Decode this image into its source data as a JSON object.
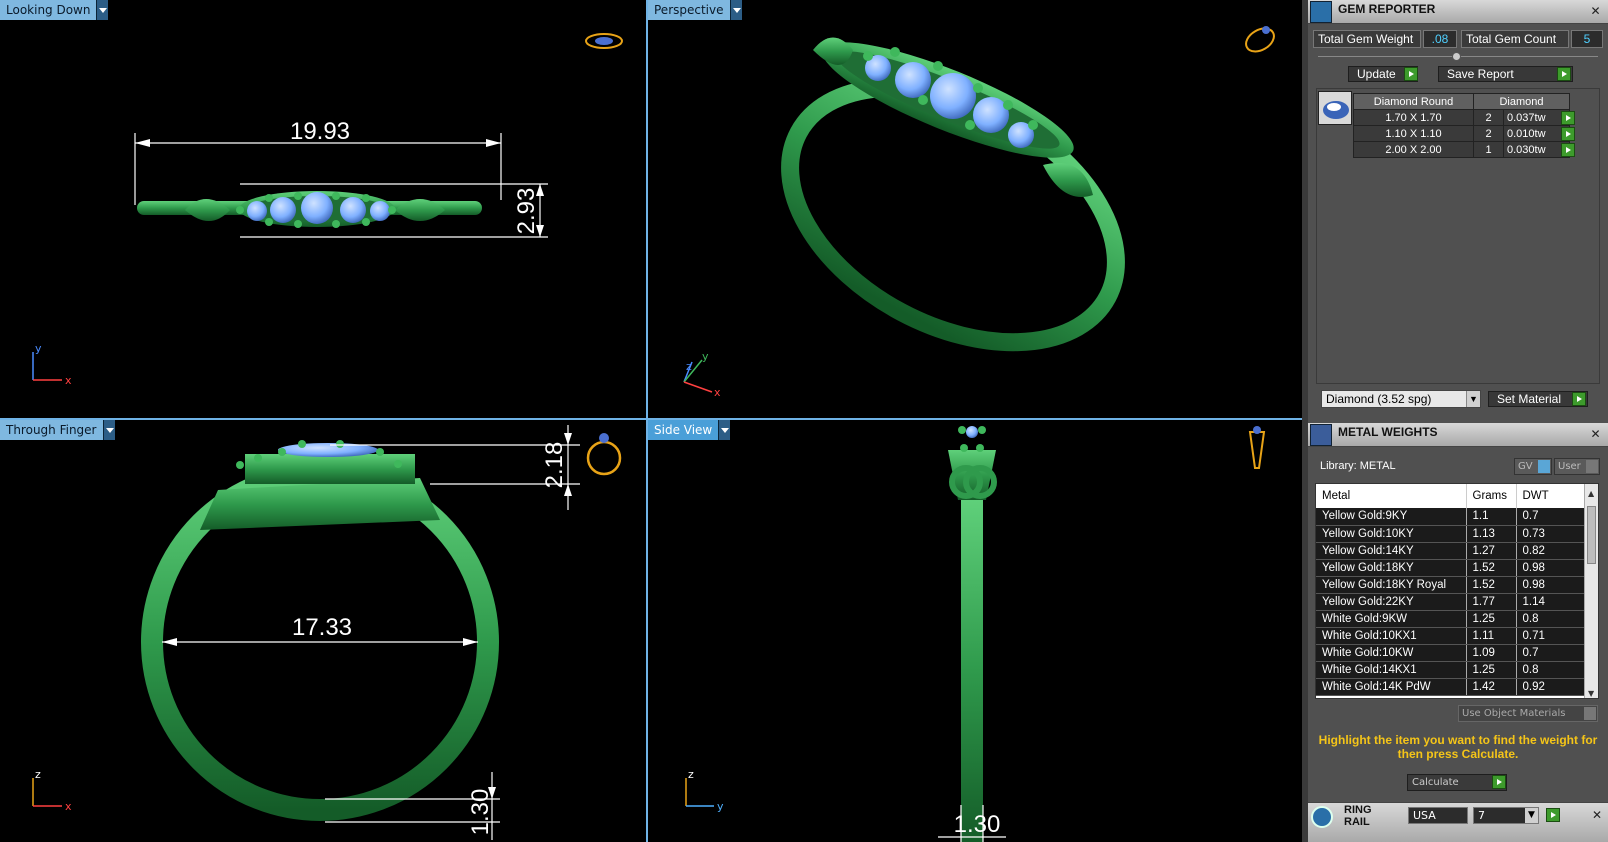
{
  "viewports": {
    "top_left": {
      "label": "Looking Down",
      "dim_width": "19.93",
      "dim_height": "2.93",
      "axes": [
        "y",
        "x"
      ]
    },
    "top_right": {
      "label": "Perspective",
      "axes": [
        "z",
        "y",
        "x"
      ]
    },
    "bottom_left": {
      "label": "Through Finger",
      "dim_top": "2.18",
      "dim_inner": "17.33",
      "dim_bottom": "1.30",
      "axes": [
        "z",
        "x"
      ]
    },
    "bottom_right": {
      "label": "Side View",
      "dim_bottom": "1.30",
      "axes": [
        "z",
        "y"
      ]
    }
  },
  "gem_reporter": {
    "title": "GEM REPORTER",
    "total_weight_label": "Total Gem Weight",
    "total_weight_value": ".08",
    "total_count_label": "Total Gem Count",
    "total_count_value": "5",
    "update_label": "Update",
    "save_label": "Save Report",
    "table_headers": [
      "Diamond Round",
      "Diamond"
    ],
    "rows": [
      {
        "size": "1.70 X 1.70",
        "count": "2",
        "tw": "0.037tw"
      },
      {
        "size": "1.10 X 1.10",
        "count": "2",
        "tw": "0.010tw"
      },
      {
        "size": "2.00 X 2.00",
        "count": "1",
        "tw": "0.030tw"
      }
    ],
    "material_select": "Diamond    (3.52 spg)",
    "set_material_label": "Set Material"
  },
  "metal_weights": {
    "title": "METAL WEIGHTS",
    "library_label": "Library: METAL",
    "gv_label": "GV",
    "user_label": "User",
    "headers": [
      "Metal",
      "Grams",
      "DWT"
    ],
    "rows": [
      {
        "metal": "Yellow Gold:9KY",
        "grams": "1.1",
        "dwt": "0.7"
      },
      {
        "metal": "Yellow Gold:10KY",
        "grams": "1.13",
        "dwt": "0.73"
      },
      {
        "metal": "Yellow Gold:14KY",
        "grams": "1.27",
        "dwt": "0.82"
      },
      {
        "metal": "Yellow Gold:18KY",
        "grams": "1.52",
        "dwt": "0.98"
      },
      {
        "metal": "Yellow Gold:18KY Royal",
        "grams": "1.52",
        "dwt": "0.98"
      },
      {
        "metal": "Yellow Gold:22KY",
        "grams": "1.77",
        "dwt": "1.14"
      },
      {
        "metal": "White Gold:9KW",
        "grams": "1.25",
        "dwt": "0.8"
      },
      {
        "metal": "White Gold:10KX1",
        "grams": "1.11",
        "dwt": "0.71"
      },
      {
        "metal": "White Gold:10KW",
        "grams": "1.09",
        "dwt": "0.7"
      },
      {
        "metal": "White Gold:14KX1",
        "grams": "1.25",
        "dwt": "0.8"
      },
      {
        "metal": "White Gold:14K PdW",
        "grams": "1.42",
        "dwt": "0.92"
      }
    ],
    "use_object_materials": "Use Object Materials",
    "note": "Highlight the item you want to find the weight for then press Calculate.",
    "calculate_label": "Calculate"
  },
  "ring_rail": {
    "title": "RING RAIL",
    "country": "USA",
    "size": "7"
  },
  "colors": {
    "metal_green": "#2f9a4c",
    "gem_blue": "#7fb0ff",
    "viewport_tag": "#7fb8e0",
    "note_yellow": "#f5c518"
  }
}
